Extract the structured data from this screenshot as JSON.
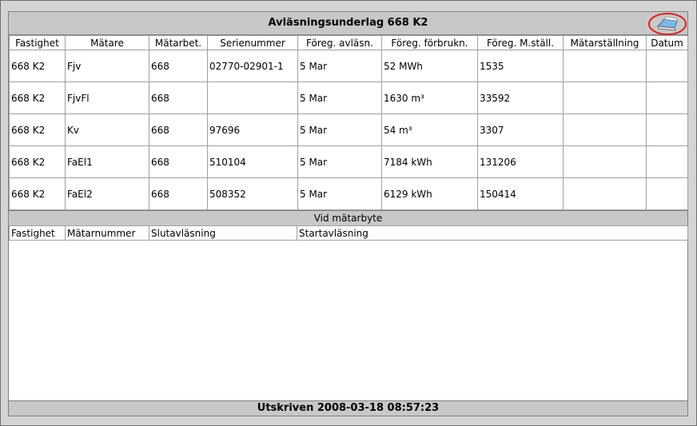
{
  "title": "Avläsningsunderlag 668 K2",
  "print_icon": "printer-icon",
  "columns": [
    "Fastighet",
    "Mätare",
    "Mätarbet.",
    "Serienummer",
    "Föreg. avläsn.",
    "Föreg. förbrukn.",
    "Föreg. M.ställ.",
    "Mätarställning",
    "Datum"
  ],
  "rows": [
    [
      "668 K2",
      "Fjv",
      "668",
      "02770-02901-1",
      "5 Mar",
      "52 MWh",
      "1535",
      "",
      ""
    ],
    [
      "668 K2",
      "FjvFl",
      "668",
      "",
      "5 Mar",
      "1630 m³",
      "33592",
      "",
      ""
    ],
    [
      "668 K2",
      "Kv",
      "668",
      "97696",
      "5 Mar",
      "54 m³",
      "3307",
      "",
      ""
    ],
    [
      "668 K2",
      "FaEl1",
      "668",
      "510104",
      "5 Mar",
      "7184 kWh",
      "131206",
      "",
      ""
    ],
    [
      "668 K2",
      "FaEl2",
      "668",
      "508352",
      "5 Mar",
      "6129 kWh",
      "150414",
      "",
      ""
    ]
  ],
  "section_meter_change": "Vid mätarbyte",
  "columns2": [
    "Fastighet",
    "Mätarnummer",
    "Slutavläsning",
    "Startavläsning"
  ],
  "footer": "Utskriven 2008-03-18 08:57:23"
}
